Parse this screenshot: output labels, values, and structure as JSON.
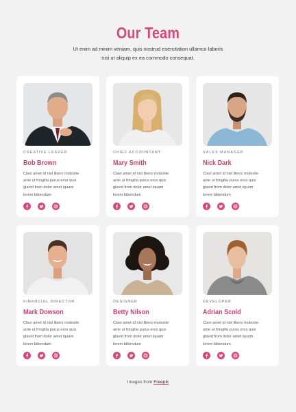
{
  "header": {
    "title": "Our Team",
    "subtitle_line1": "Ut enim ad minim veniam, quis nostrud exercitation ullamco laboris",
    "subtitle_line2": "nisi ut aliquip ex ea commodo consequat."
  },
  "colors": {
    "accent": "#d6487a",
    "name": "#c8436f",
    "background": "#f2f2f2"
  },
  "members": [
    {
      "role": "CREATIVE LEADER",
      "name": "Bob Brown",
      "desc": [
        "Clavi amet id nisl libero molestie",
        "ante ut fringilla purus eros quis",
        "glavid from dolor amet iquam",
        "lorem bibendum"
      ]
    },
    {
      "role": "CHIEF ACCOUNTANT",
      "name": "Mary Smith",
      "desc": [
        "Clavi amet id nisl libero molestie",
        "ante ut fringilla purus eros quis",
        "glavid from dolor amet iquam",
        "lorem bibendum"
      ]
    },
    {
      "role": "SALES MANAGER",
      "name": "Nick Dark",
      "desc": [
        "Clavi amet id nisl libero molestie",
        "ante ut fringilla purus eros quis",
        "glavid from dolor amet iquam",
        "lorem bibendum"
      ]
    },
    {
      "role": "FINANCIAL DIRECTOR",
      "name": "Mark Dowson",
      "desc": [
        "Clavi amet id nisl libero molestie",
        "ante ut fringilla purus eros quis",
        "glavid from dolor amet iquam",
        "lorem bibendum"
      ]
    },
    {
      "role": "DESIGNER",
      "name": "Betty Nilson",
      "desc": [
        "Clavi amet id nisl libero molestie",
        "ante ut fringilla purus eros quis",
        "glavid from dolor amet iquam",
        "lorem bibendum"
      ]
    },
    {
      "role": "DEVELOPER",
      "name": "Adrian Scold",
      "desc": [
        "Clavi amet id nisl libero molestie",
        "ante ut fringilla purus eros quis",
        "glavid from dolor amet iquam",
        "lorem bibendum"
      ]
    }
  ],
  "social_icons": [
    "facebook-icon",
    "twitter-icon",
    "instagram-icon"
  ],
  "footer": {
    "credit_text": "Images from",
    "credit_link": "Freepik"
  }
}
